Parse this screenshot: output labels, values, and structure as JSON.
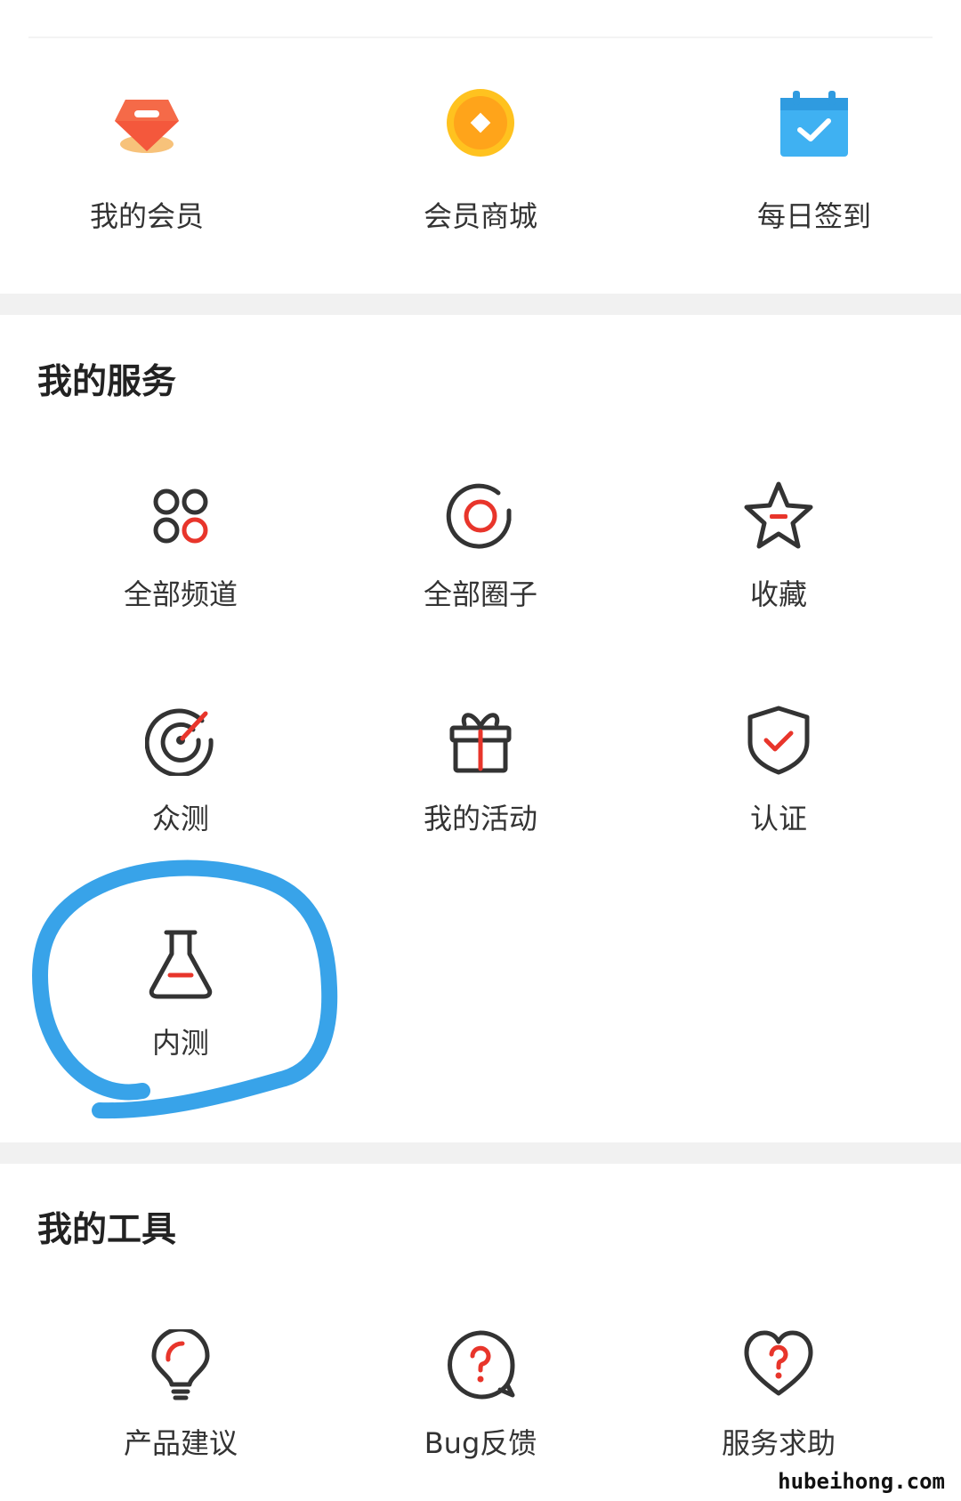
{
  "member": {
    "items": [
      {
        "label": "我的会员",
        "icon": "diamond-icon"
      },
      {
        "label": "会员商城",
        "icon": "coin-icon"
      },
      {
        "label": "每日签到",
        "icon": "calendar-check-icon"
      }
    ]
  },
  "services": {
    "title": "我的服务",
    "items": [
      {
        "label": "全部频道",
        "icon": "channels-grid-icon"
      },
      {
        "label": "全部圈子",
        "icon": "circle-at-icon"
      },
      {
        "label": "收藏",
        "icon": "star-icon"
      },
      {
        "label": "众测",
        "icon": "radar-icon"
      },
      {
        "label": "我的活动",
        "icon": "gift-icon"
      },
      {
        "label": "认证",
        "icon": "shield-check-icon"
      },
      {
        "label": "内测",
        "icon": "flask-icon"
      }
    ]
  },
  "tools": {
    "title": "我的工具",
    "items": [
      {
        "label": "产品建议",
        "icon": "lightbulb-icon"
      },
      {
        "label": "Bug反馈",
        "icon": "question-bubble-icon"
      },
      {
        "label": "服务求助",
        "icon": "heart-question-icon"
      }
    ]
  },
  "watermark": "hubeihong.com",
  "colors": {
    "accent_red": "#e8352b",
    "icon_gray": "#333333",
    "annotation_blue": "#2d9ee8",
    "band_gray": "#f1f1f1"
  }
}
